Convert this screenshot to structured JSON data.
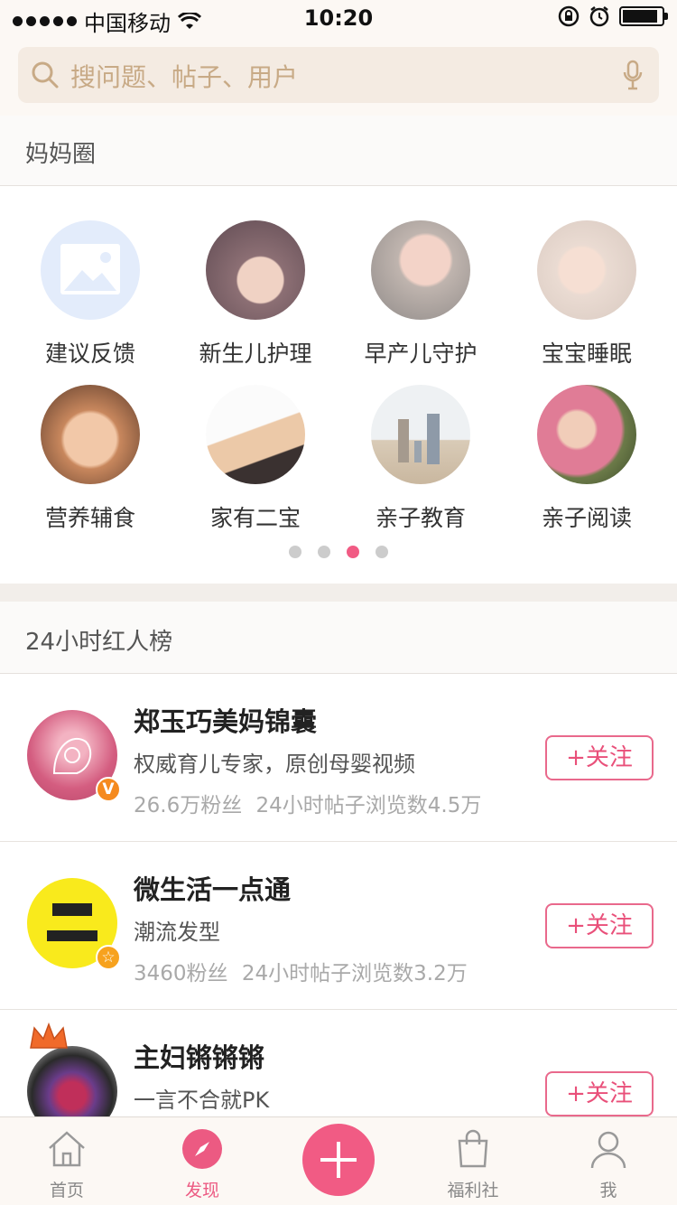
{
  "status_bar": {
    "carrier": "中国移动",
    "time": "10:20"
  },
  "search": {
    "placeholder": "搜问题、帖子、用户"
  },
  "circles_section": {
    "title": "妈妈圈",
    "items": [
      {
        "label": "建议反馈"
      },
      {
        "label": "新生儿护理"
      },
      {
        "label": "早产儿守护"
      },
      {
        "label": "宝宝睡眠"
      },
      {
        "label": "营养辅食"
      },
      {
        "label": "家有二宝"
      },
      {
        "label": "亲子教育"
      },
      {
        "label": "亲子阅读"
      }
    ],
    "page_count": 4,
    "active_page": 3
  },
  "ranking_section": {
    "title": "24小时红人榜",
    "users": [
      {
        "name": "郑玉巧美妈锦囊",
        "desc": "权威育儿专家，原创母婴视频",
        "fans": "26.6万粉丝",
        "views": "24小时帖子浏览数4.5万",
        "badge": "V",
        "follow": "+关注"
      },
      {
        "name": "微生活一点通",
        "desc": "潮流发型",
        "fans": "3460粉丝",
        "views": "24小时帖子浏览数3.2万",
        "badge": "☆",
        "follow": "+关注"
      },
      {
        "name": "主妇锵锵锵",
        "desc": "一言不合就PK",
        "fans": "",
        "views": "",
        "badge": "",
        "follow": "+关注"
      }
    ]
  },
  "tab_bar": {
    "tabs": [
      {
        "label": "首页"
      },
      {
        "label": "发现"
      },
      {
        "label": "福利社"
      },
      {
        "label": "我"
      }
    ],
    "active": "发现"
  },
  "colors": {
    "accent": "#f15b84",
    "follow_text": "#e9507a",
    "placeholder": "#c8aa86"
  }
}
